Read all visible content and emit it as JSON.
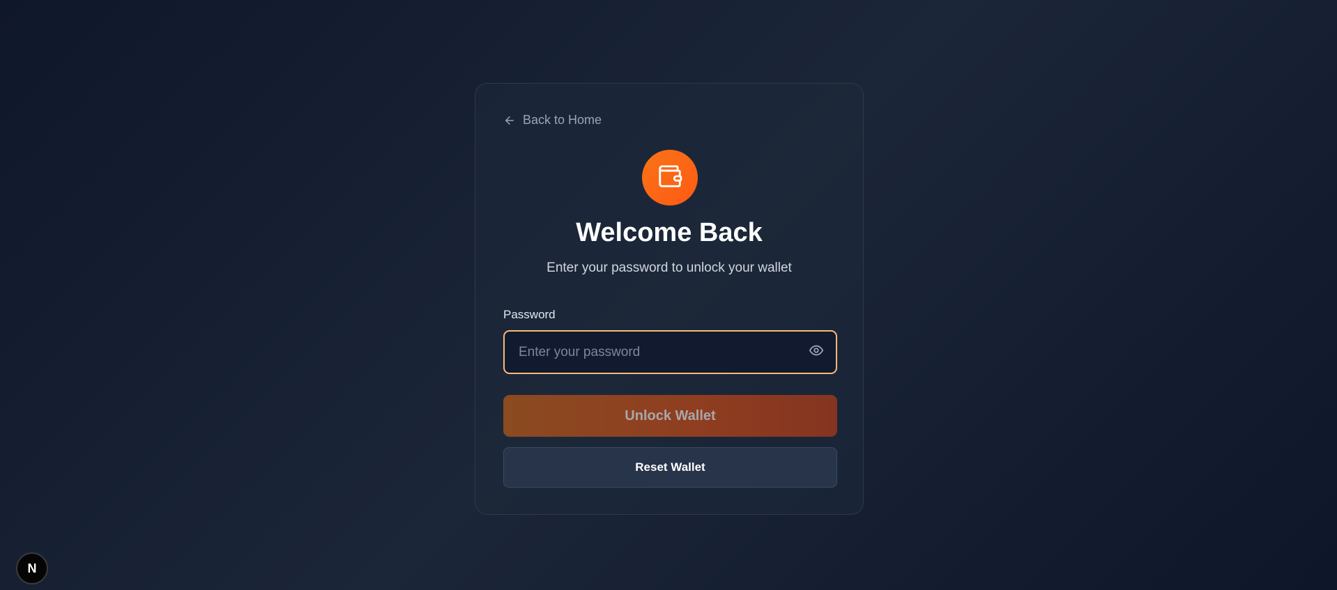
{
  "back_link": {
    "label": "Back to Home",
    "icon": "arrow-left-icon"
  },
  "logo": {
    "icon": "wallet-icon",
    "color": "#f97316"
  },
  "heading": {
    "title": "Welcome Back",
    "subtitle": "Enter your password to unlock your wallet"
  },
  "password_field": {
    "label": "Password",
    "placeholder": "Enter your password",
    "value": "",
    "toggle_icon": "eye-icon"
  },
  "buttons": {
    "unlock_label": "Unlock Wallet",
    "reset_label": "Reset Wallet"
  },
  "dev_badge": {
    "label": "N"
  },
  "colors": {
    "accent": "#f97316",
    "input_focus_border": "#fdba74",
    "background": "#0f172a"
  }
}
